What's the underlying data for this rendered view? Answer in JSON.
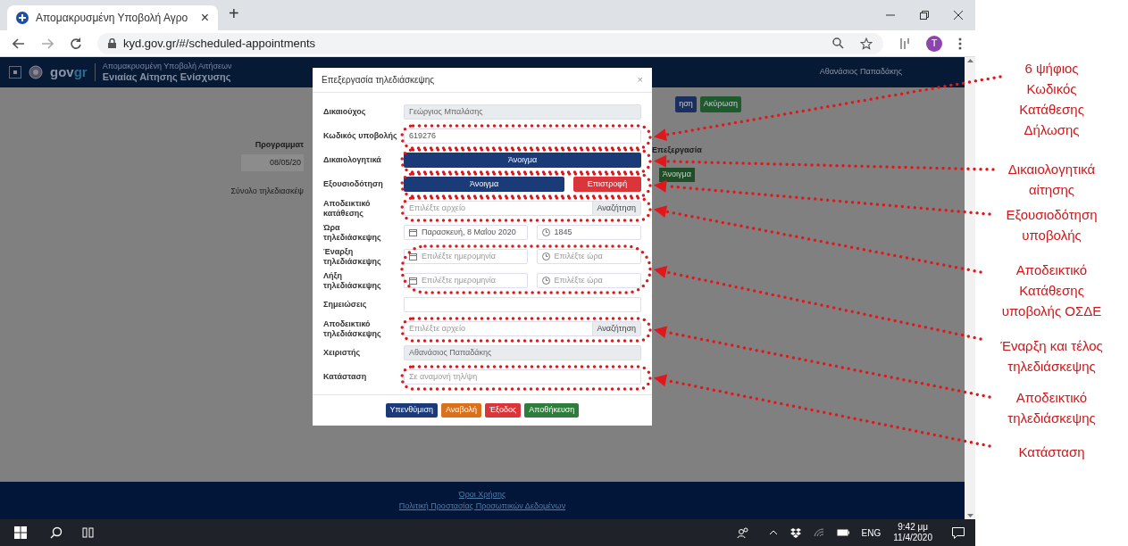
{
  "browser": {
    "tab_title": "Απομακρυσμένη Υποβολή Αγρο",
    "tab_close": "×",
    "new_tab": "+",
    "url": "kyd.gov.gr/#/scheduled-appointments",
    "profile_initial": "T"
  },
  "header": {
    "logo": "gov",
    "logo_accent": "gr",
    "subtitle": "Απομακρυσμένη Υποβολή Αιτήσεων",
    "title": "Ενιαίας Αίτησης Ενίσχυσης",
    "user": "Αθανάσιος Παπαδάκης"
  },
  "background": {
    "scheduled_heading": "Προγραμματ",
    "scheduled_date": "08/05/20",
    "total": "Σύνολο τηλεδιασκέψ",
    "edit_heading": "Επεξεργασία",
    "edit_button": "Άνοιγμα",
    "buttons": [
      {
        "label": "ηση",
        "color": "#1b2f5e"
      },
      {
        "label": "Ακύρωση",
        "color": "#1f5a2c"
      }
    ]
  },
  "modal": {
    "title": "Επεξεργασία τηλεδιάσκεψης",
    "close": "×",
    "rows": [
      {
        "kind": "text",
        "label": "Δικαιούχος",
        "value": "Γεώργιος Μπαλάσης",
        "disabled": true
      },
      {
        "kind": "text",
        "label": "Κωδικός υποβολής",
        "value": "619276",
        "disabled": false
      },
      {
        "kind": "buttons",
        "label": "Δικαιολογητικά",
        "buttons": [
          {
            "label": "Άνοιγμα",
            "color": "#1b3a78"
          }
        ]
      },
      {
        "kind": "buttons",
        "label": "Εξουσιοδότηση",
        "buttons": [
          {
            "label": "Άνοιγμα",
            "color": "#1b3a78"
          },
          {
            "label": "Επιστροφή",
            "color": "#d9353a"
          }
        ]
      },
      {
        "kind": "file",
        "label": "Αποδεικτικό κατάθεσης",
        "placeholder": "Επιλέξτε αρχείο",
        "button": "Αναζήτηση"
      },
      {
        "kind": "datetime",
        "label": "Ώρα τηλεδιάσκεψης",
        "date": "Παρασκευή, 8 Μαΐου 2020",
        "time": "1845"
      },
      {
        "kind": "datetime",
        "label": "Έναρξη τηλεδιάσκεψης",
        "date_placeholder": "Επιλέξτε ημερομηνία",
        "time_placeholder": "Επιλέξτε ώρα"
      },
      {
        "kind": "datetime",
        "label": "Λήξη τηλεδιάσκεψης",
        "date_placeholder": "Επιλέξτε ημερομηνία",
        "time_placeholder": "Επιλέξτε ώρα"
      },
      {
        "kind": "text",
        "label": "Σημειώσεις",
        "disabled": false
      },
      {
        "kind": "file",
        "label": "Αποδεικτικό τηλεδιάσκεψης",
        "placeholder": "Επιλέξτε αρχείο",
        "button": "Αναζήτηση"
      },
      {
        "kind": "text",
        "label": "Χειριστής",
        "value": "Αθανάσιος Παπαδάκης",
        "disabled": true
      },
      {
        "kind": "text",
        "label": "Κατάσταση",
        "placeholder": "Σε αναμονή τηλ/ψη",
        "disabled": false
      }
    ],
    "footer_buttons": [
      {
        "label": "Υπενθύμιση",
        "color": "#1b3a78"
      },
      {
        "label": "Αναβολή",
        "color": "#d9711c"
      },
      {
        "label": "Έξοδος",
        "color": "#d9353a"
      },
      {
        "label": "Αποθήκευση",
        "color": "#2e7d3a"
      }
    ]
  },
  "page_footer": {
    "links": [
      "Όροι Χρήσης",
      "Πολιτική Προστασίας Προσωπικών Δεδομένων"
    ]
  },
  "taskbar": {
    "language": "ENG",
    "time": "9:42 μμ",
    "date": "11/4/2020"
  },
  "annotations": [
    {
      "lines": [
        "6 ψήφιος",
        "Κωδικός",
        "Κατάθεσης",
        "Δήλωσης"
      ]
    },
    {
      "lines": [
        "Δικαιολογητικά",
        "αίτησης"
      ]
    },
    {
      "lines": [
        "Εξουσιοδότηση",
        "υποβολής"
      ]
    },
    {
      "lines": [
        "Αποδεικτικό",
        "Κατάθεσης",
        "υποβολής ΟΣΔΕ"
      ]
    },
    {
      "lines": [
        "Έναρξη και τέλος",
        "τηλεδιάσκεψης"
      ]
    },
    {
      "lines": [
        "Αποδεικτικό",
        "τηλεδιάσκεψης"
      ]
    },
    {
      "lines": [
        "Κατάσταση"
      ]
    }
  ]
}
